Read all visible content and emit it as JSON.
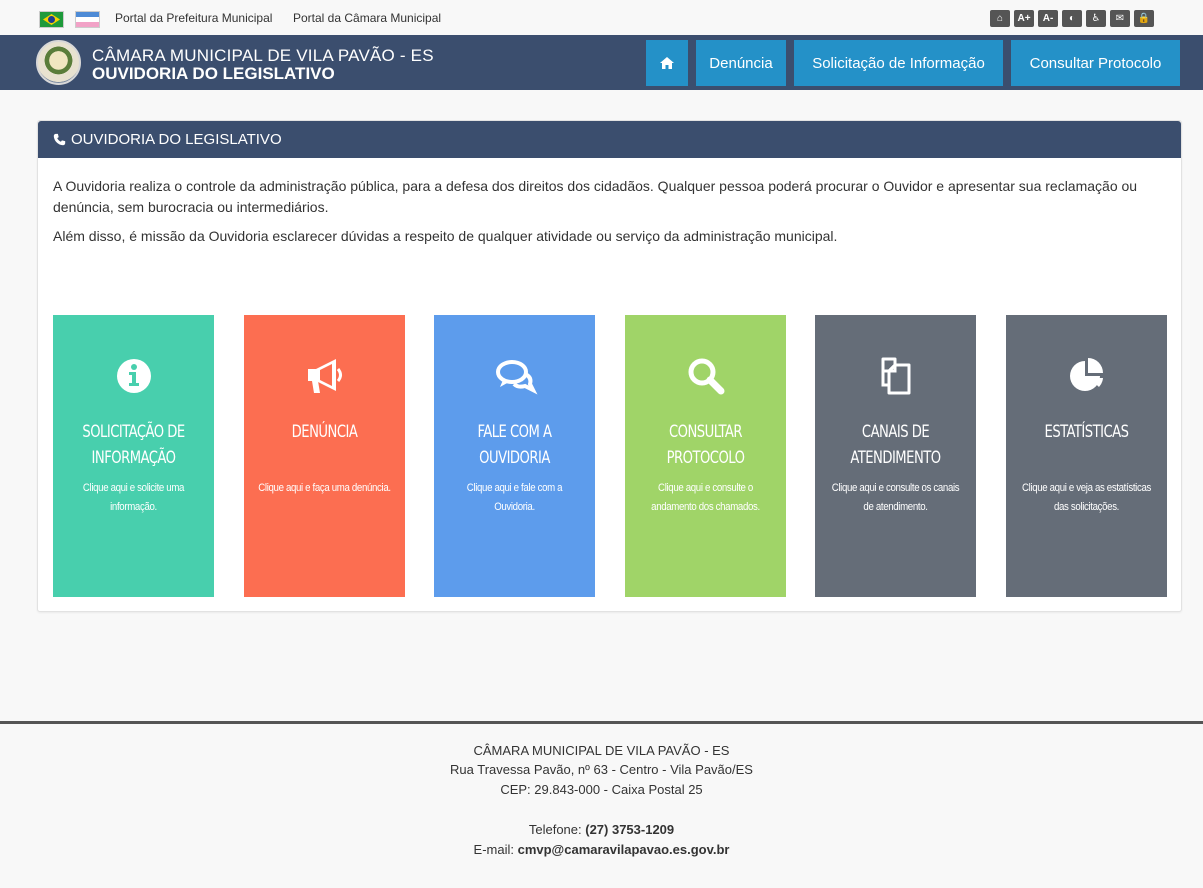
{
  "topbar": {
    "link_prefeitura": "Portal da Prefeitura Municipal",
    "link_camara": "Portal da Câmara Municipal",
    "access_buttons": [
      "⌂",
      "A+",
      "A-",
      "◐",
      "♿",
      "✉",
      "🔒"
    ]
  },
  "header": {
    "title_line1": "CÂMARA MUNICIPAL DE VILA PAVÃO - ES",
    "title_line2": "OUVIDORIA DO LEGISLATIVO",
    "nav": {
      "home": "⌂",
      "denuncia": "Denúncia",
      "solicitacao": "Solicitação de Informação",
      "consultar": "Consultar Protocolo"
    }
  },
  "panel": {
    "title": "OUVIDORIA DO LEGISLATIVO",
    "paragraph1": "A Ouvidoria realiza o controle da administração pública, para a defesa dos direitos dos cidadãos. Qualquer pessoa poderá procurar o Ouvidor e apresentar sua reclamação ou denúncia, sem burocracia ou intermediários.",
    "paragraph2": "Além disso, é missão da Ouvidoria esclarecer dúvidas a respeito de qualquer atividade ou serviço da administração municipal."
  },
  "cards": [
    {
      "title": "SOLICITAÇÃO DE INFORMAÇÃO",
      "desc": "Clique aqui e solicite uma informação.",
      "color": "#48cfad",
      "icon": "info-icon"
    },
    {
      "title": "DENÚNCIA",
      "desc": "Clique aqui e faça uma denúncia.",
      "color": "#fc6e51",
      "icon": "bullhorn-icon"
    },
    {
      "title": "FALE COM A OUVIDORIA",
      "desc": "Clique aqui e fale com a Ouvidoria.",
      "color": "#5d9cec",
      "icon": "comments-icon"
    },
    {
      "title": "CONSULTAR PROTOCOLO",
      "desc": "Clique aqui e consulte o andamento dos chamados.",
      "color": "#a0d468",
      "icon": "search-icon"
    },
    {
      "title": "CANAIS DE ATENDIMENTO",
      "desc": "Clique aqui e consulte os canais de atendimento.",
      "color": "#656d78",
      "icon": "copy-icon"
    },
    {
      "title": "ESTATÍSTICAS",
      "desc": "Clique aqui e veja as estatísticas das solicitações.",
      "color": "#656d78",
      "icon": "pie-chart-icon"
    }
  ],
  "footer": {
    "name": "CÂMARA MUNICIPAL DE VILA PAVÃO - ES",
    "address": "Rua Travessa Pavão, nº 63 - Centro - Vila Pavão/ES",
    "cep": "CEP: 29.843-000 - Caixa Postal 25",
    "phone_label": "Telefone: ",
    "phone": "(27) 3753-1209",
    "email_label": "E-mail: ",
    "email": "cmvp@camaravilapavao.es.gov.br"
  }
}
